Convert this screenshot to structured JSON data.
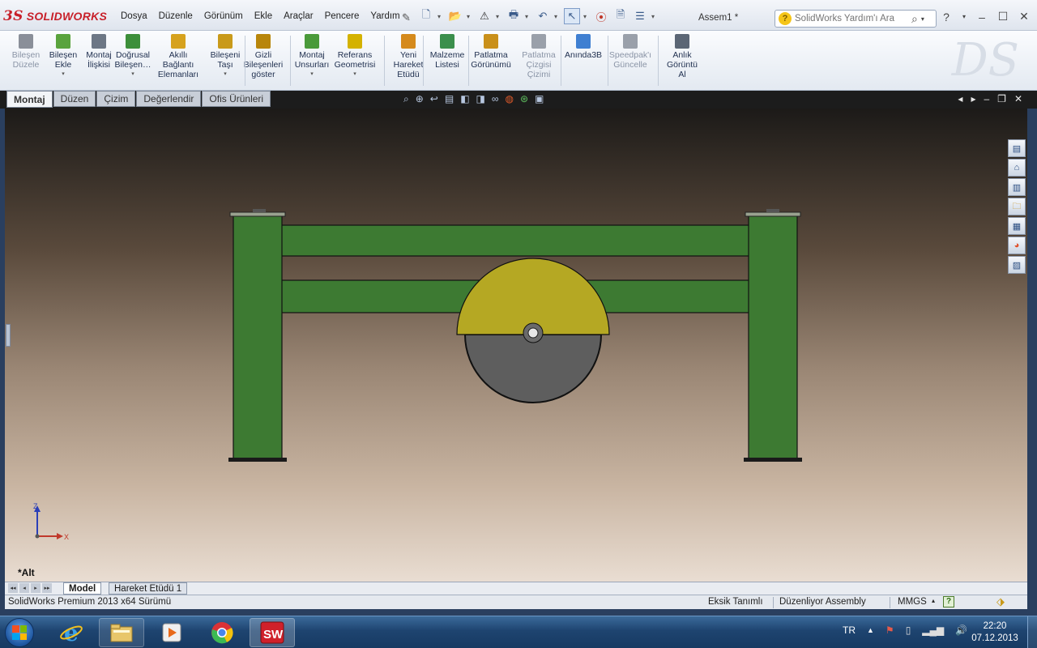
{
  "app": {
    "logo_prefix": "3S",
    "logo_text": "SOLIDWORKS",
    "document_title": "Assem1 *"
  },
  "menu": [
    "Dosya",
    "Düzenle",
    "Görünüm",
    "Ekle",
    "Araçlar",
    "Pencere",
    "Yardım"
  ],
  "help_search": {
    "placeholder": "SolidWorks Yardım'ı Ara"
  },
  "command_manager": [
    {
      "id": "bilesen-duzenle",
      "label": "Bileşen Düzele",
      "disabled": true,
      "dropdown": false,
      "color": "#8a8f99"
    },
    {
      "id": "bilesen-ekle",
      "label": "Bileşen Ekle",
      "disabled": false,
      "dropdown": true,
      "color": "#5aa33d"
    },
    {
      "id": "montaj-iliskisi",
      "label": "Montaj İlişkisi",
      "disabled": false,
      "dropdown": false,
      "color": "#6d7785"
    },
    {
      "id": "dogrusal-bilesen",
      "label": "Doğrusal Bileşen…",
      "disabled": false,
      "dropdown": true,
      "color": "#3d8f3a"
    },
    {
      "id": "akilli-baglanti",
      "label": "Akıllı Bağlantı Elemanları",
      "disabled": false,
      "dropdown": false,
      "color": "#d6a21e"
    },
    {
      "id": "bileseni-tasi",
      "label": "Bileşeni Taşı",
      "disabled": false,
      "dropdown": true,
      "color": "#c99a1a"
    },
    {
      "id": "gizli-bilesenler",
      "label": "Gizli Bileşenleri göster",
      "disabled": false,
      "dropdown": false,
      "color": "#b8860b"
    },
    {
      "id": "montaj-unsurlari",
      "label": "Montaj Unsurları",
      "disabled": false,
      "dropdown": true,
      "color": "#4a9a3a"
    },
    {
      "id": "referans-geometrisi",
      "label": "Referans Geometrisi",
      "disabled": false,
      "dropdown": true,
      "color": "#d4b200"
    },
    {
      "id": "yeni-hareket",
      "label": "Yeni Hareket Etüdü",
      "disabled": false,
      "dropdown": false,
      "color": "#d58a1c"
    },
    {
      "id": "malzeme-listesi",
      "label": "Malzeme Listesi",
      "disabled": false,
      "dropdown": false,
      "color": "#3b8f4c"
    },
    {
      "id": "patlatma-gorunumu",
      "label": "Patlatma Görünümü",
      "disabled": false,
      "dropdown": false,
      "color": "#c9901a"
    },
    {
      "id": "patlatma-cizgisi",
      "label": "Patlatma Çizgisi Çizimi",
      "disabled": true,
      "dropdown": false,
      "color": "#9aa0aa"
    },
    {
      "id": "aninda-3b",
      "label": "Anında3B",
      "disabled": false,
      "dropdown": false,
      "color": "#3f7fd1"
    },
    {
      "id": "speedpak",
      "label": "Speedpak'ı Güncelle",
      "disabled": true,
      "dropdown": false,
      "color": "#9aa0aa"
    },
    {
      "id": "anlik-goruntu",
      "label": "Anlık Görüntü Al",
      "disabled": false,
      "dropdown": false,
      "color": "#5b6675"
    }
  ],
  "tabs": [
    {
      "label": "Montaj",
      "active": true
    },
    {
      "label": "Düzen",
      "active": false
    },
    {
      "label": "Çizim",
      "active": false
    },
    {
      "label": "Değerlendir",
      "active": false
    },
    {
      "label": "Ofis Ürünleri",
      "active": false
    }
  ],
  "viewport": {
    "view_name": "*Alt",
    "triad": {
      "z": "Z",
      "x": "X"
    },
    "colors": {
      "frame_green": "#3d7a32",
      "blade_top": "#b5a823",
      "blade_bottom": "#5e5e5e"
    }
  },
  "bottom_tabs": [
    {
      "label": "Model",
      "active": true
    },
    {
      "label": "Hareket Etüdü 1",
      "active": false
    }
  ],
  "status_bar": {
    "version": "SolidWorks Premium 2013 x64 Sürümü",
    "definition": "Eksik Tanımlı",
    "mode": "Düzenliyor Assembly",
    "units": "ΜMGS"
  },
  "taskbar": {
    "language": "TR",
    "time": "22:20",
    "date": "07.12.2013",
    "apps": [
      "internet-explorer",
      "file-explorer",
      "media-player",
      "chrome",
      "solidworks"
    ]
  }
}
